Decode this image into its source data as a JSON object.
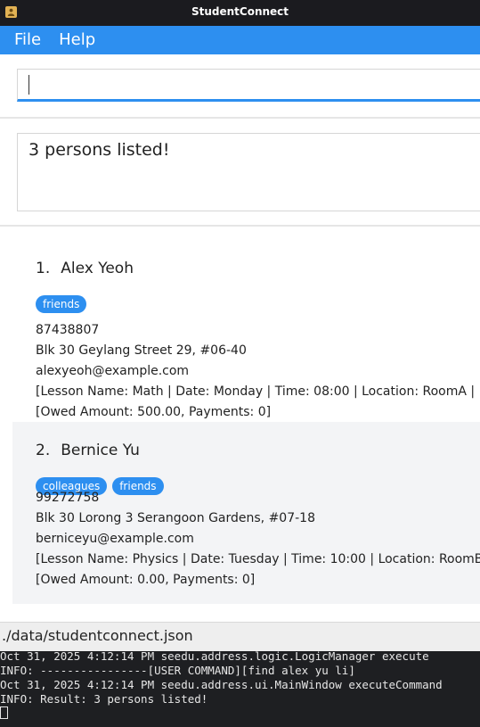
{
  "window": {
    "title": "StudentConnect",
    "app_icon": "app-icon"
  },
  "menu": {
    "items": [
      {
        "label": "File"
      },
      {
        "label": "Help"
      }
    ]
  },
  "command_box": {
    "value": ""
  },
  "result": {
    "message": "3 persons listed!"
  },
  "persons": [
    {
      "index": "1.",
      "name": "Alex Yeoh",
      "tags": [
        "friends"
      ],
      "phone": "87438807",
      "address": "Blk 30 Geylang Street 29, #06-40",
      "email": "alexyeoh@example.com",
      "lesson": "[Lesson Name: Math | Date: Monday | Time: 08:00 | Location: RoomA |",
      "payment": "[Owed Amount: 500.00, Payments: 0]"
    },
    {
      "index": "2.",
      "name": "Bernice Yu",
      "tags": [
        "colleagues",
        "friends"
      ],
      "phone": "99272758",
      "address": "Blk 30 Lorong 3 Serangoon Gardens, #07-18",
      "email": "berniceyu@example.com",
      "lesson": "[Lesson Name: Physics | Date: Tuesday | Time: 10:00 | Location: RoomB",
      "payment": "[Owed Amount: 0.00, Payments: 0]"
    }
  ],
  "status_bar": {
    "file_path": "./data/studentconnect.json"
  },
  "terminal": {
    "lines": [
      "Oct 31, 2025 4:12:14 PM seedu.address.logic.LogicManager execute",
      "INFO: ----------------[USER COMMAND][find alex yu li]",
      "Oct 31, 2025 4:12:14 PM seedu.address.ui.MainWindow executeCommand",
      "INFO: Result: 3 persons listed!"
    ]
  },
  "colors": {
    "accent": "#2d8ff0",
    "titlebar": "#1b1b1f",
    "terminal_bg": "#1e1f22"
  }
}
